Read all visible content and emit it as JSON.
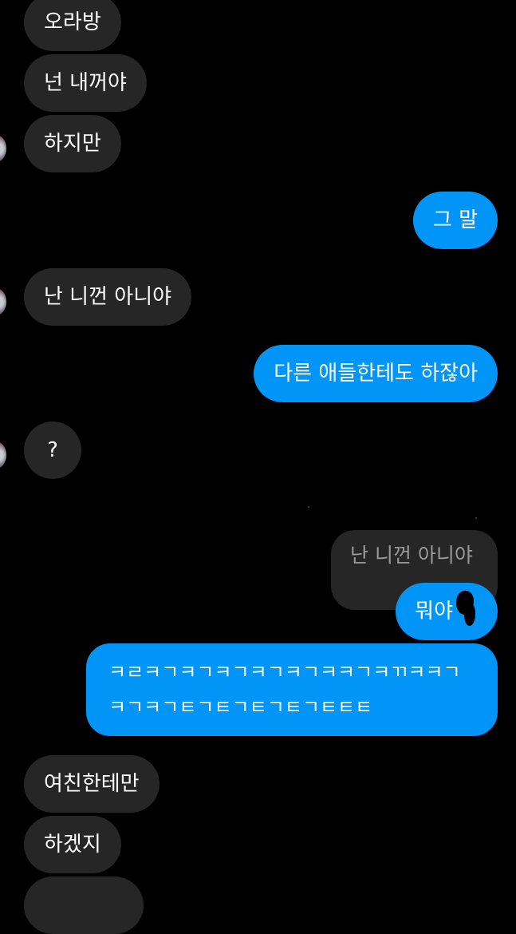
{
  "messages": [
    {
      "id": "m1",
      "side": "in",
      "text": "오라방"
    },
    {
      "id": "m2",
      "side": "in",
      "text": "넌 내꺼야"
    },
    {
      "id": "m3",
      "side": "in",
      "text": "하지만"
    },
    {
      "id": "m4",
      "side": "out",
      "text": "그 말"
    },
    {
      "id": "m5",
      "side": "in",
      "text": "난 니껀 아니야"
    },
    {
      "id": "m6",
      "side": "out",
      "text": "다른 애들한테도 하잖아"
    },
    {
      "id": "m7",
      "side": "in",
      "text": "?"
    },
    {
      "id": "m8",
      "side": "out",
      "reply_to": "난 니껀 아니야",
      "text": "뭐야"
    },
    {
      "id": "m9",
      "side": "out",
      "text_line1": "ㅋㄹㅋㄱㅋㄱㅋㄱㅋㄱㅋㄱㅋㅋㄱㅋㄲㅋㅋㄱ",
      "text_line2": "ㅋㄱㅋㄱㅌㄱㅌㄱㅌㄱㅌㄱㅌㅌㅌ"
    },
    {
      "id": "m10",
      "side": "in",
      "text": "여친한테만"
    },
    {
      "id": "m11",
      "side": "in",
      "text": "하겠지"
    }
  ],
  "colors": {
    "background": "#000000",
    "incoming_bubble": "#262626",
    "outgoing_bubble": "#0095f6",
    "text": "#ffffff",
    "quoted_text": "#9a9a9a"
  }
}
